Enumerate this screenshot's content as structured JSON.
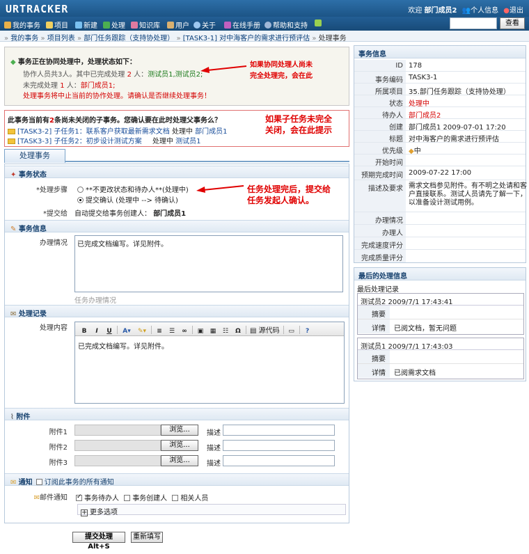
{
  "header": {
    "logo": "URTRACKER",
    "welcome_prefix": "欢迎",
    "user": "部门成员2",
    "profile": "个人信息",
    "logout": "退出"
  },
  "nav": {
    "items": [
      "我的事务",
      "项目",
      "新建",
      "处理",
      "知识库",
      "用户",
      "关于",
      "在线手册",
      "帮助和支持"
    ],
    "search_button": "查看"
  },
  "breadcrumb": [
    "我的事务",
    "项目列表",
    "部门任务跟踪（支持协处理）",
    "[TASK3-1] 对中海客户的需求进行预评估",
    "处理事务"
  ],
  "coop": {
    "title": "事务正在协同处理中，处理状态如下：",
    "line1_prefix": "协作人员共3人。其中已完成处理",
    "line1_count": "2",
    "line1_mid": "人：",
    "line1_names": "测试员1,测试员2;",
    "line2_prefix": "未完成处理",
    "line2_count": "1",
    "line2_mid": "人：",
    "line2_names": "部门成员1;",
    "line3": "处理事务将中止当前的协作处理。请确认是否继续处理事务！",
    "annotation_1": "如果协同处理人尚未",
    "annotation_2": "完全处理完，会在此"
  },
  "subtask": {
    "title_prefix": "此事务当前有",
    "title_count": "2",
    "title_suffix": "条尚未关闭的子事务。您确认要在此时处理父事务么？",
    "items": [
      {
        "link": "[TASK3-2] 子任务1：联系客户获取最新需求文档",
        "status": "处理中",
        "owner": "部门成员1"
      },
      {
        "link": "[TASK3-3] 子任务2：初步设计测试方案",
        "status": "处理中",
        "owner": "测试员1"
      }
    ],
    "annotation_1": "如果子任务未完全",
    "annotation_2": "关闭，会在此提示"
  },
  "tab": "处理事务",
  "form": {
    "sec_status": "事务状态",
    "step_label": "*处理步骤",
    "opt1": "**不更改状态和待办人**(处理中)",
    "opt2": "提交确认 (处理中 --> 待确认)",
    "submit_to_label": "*提交给",
    "submit_to_prefix": "自动提交给事务创建人：",
    "submit_to_user": "部门成员1",
    "annotation_1": "任务处理完后，提交给",
    "annotation_2": "任务发起人确认。",
    "sec_info": "事务信息",
    "handle_label": "办理情况",
    "handle_value": "已完成文档编写。详见附件。",
    "handle_hint": "任务办理情况",
    "sec_record": "处理记录",
    "content_label": "处理内容",
    "source_btn": "源代码",
    "editor_value": "已完成文档编写。详见附件。",
    "sec_attach": "附件",
    "attach": [
      {
        "label": "附件1",
        "browse": "浏览...",
        "desc": "描述"
      },
      {
        "label": "附件2",
        "browse": "浏览...",
        "desc": "描述"
      },
      {
        "label": "附件3",
        "browse": "浏览...",
        "desc": "描述"
      }
    ],
    "sec_notify": "通知",
    "subscribe": "订阅此事务的所有通知",
    "mail_label": "邮件通知",
    "mail_opts": [
      "事务待办人",
      "事务创建人",
      "相关人员"
    ],
    "more": "更多选项",
    "submit": "提交处理 Alt+S",
    "reset": "重新填写"
  },
  "info": {
    "title": "事务信息",
    "rows": [
      {
        "k": "ID",
        "v": "178"
      },
      {
        "k": "事务编码",
        "v": "TASK3-1"
      },
      {
        "k": "所属项目",
        "v": "35.部门任务跟踪（支持协处理）"
      },
      {
        "k": "状态",
        "v": "处理中"
      },
      {
        "k": "待办人",
        "v": "部门成员2"
      },
      {
        "k": "创建",
        "v": "部门成员1 2009-07-01 17:20"
      },
      {
        "k": "标题",
        "v": "对中海客户的需求进行预评估"
      },
      {
        "k": "优先级",
        "v": "中"
      },
      {
        "k": "开始时间",
        "v": ""
      },
      {
        "k": "预期完成时间",
        "v": "2009-07-22 17:00"
      },
      {
        "k": "描述及要求",
        "v1": "需求文档参见附件。有不明之处请和客",
        "v2": "户直接联系。测试人员请先了解一下，",
        "v3": "以准备设计测试用例。"
      },
      {
        "k": "办理情况",
        "v": ""
      },
      {
        "k": "办理人",
        "v": ""
      },
      {
        "k": "完成速度评分",
        "v": ""
      },
      {
        "k": "完成质量评分",
        "v": ""
      }
    ]
  },
  "last": {
    "title": "最后的处理信息",
    "subtitle": "最后处理记录",
    "records": [
      {
        "head": "测试员2 2009/7/1 17:43:41",
        "summary_k": "摘要",
        "detail_k": "详情",
        "detail": "已阅文档，暂无问题"
      },
      {
        "head": "测试员1 2009/7/1 17:43:03",
        "summary_k": "摘要",
        "detail_k": "详情",
        "detail": "已阅需求文档"
      }
    ]
  },
  "colors": {
    "accent": "#1c5486",
    "warn": "#d40000",
    "link": "#1a4e9a"
  }
}
